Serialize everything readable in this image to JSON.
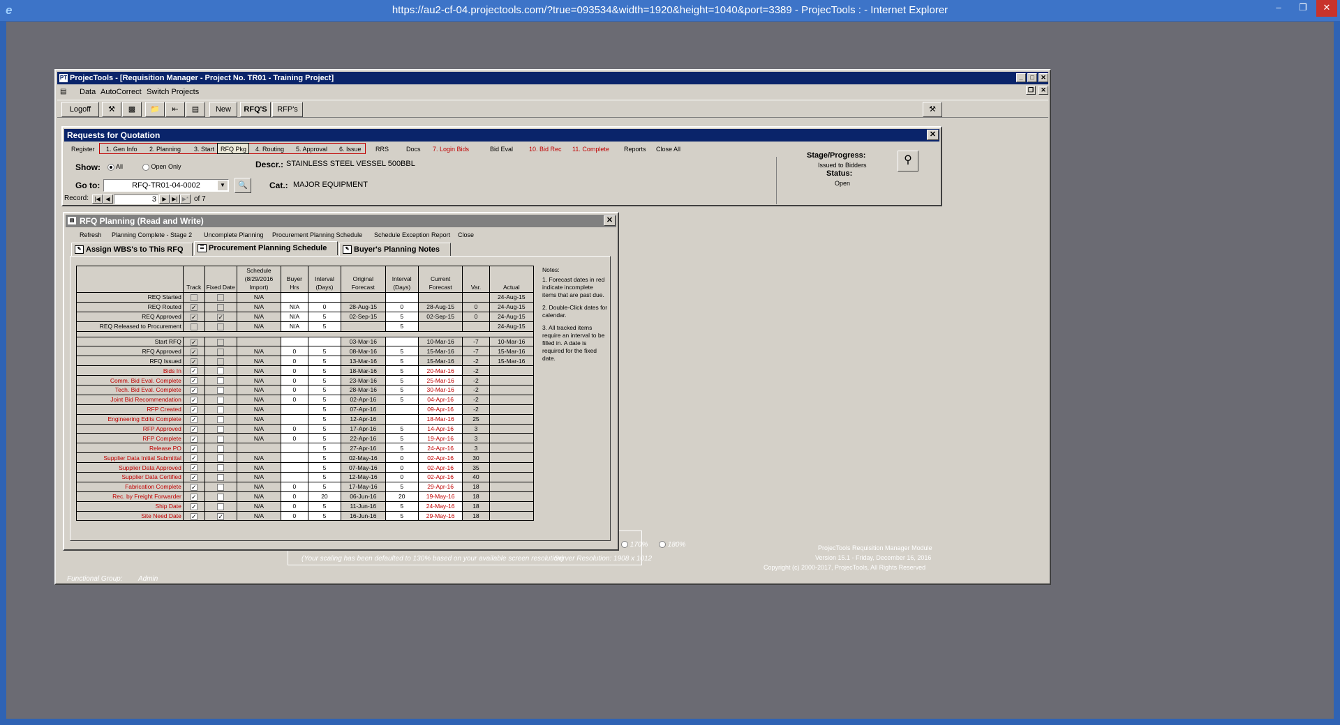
{
  "browser": {
    "title": "https://au2-cf-04.projectools.com/?true=093534&width=1920&height=1040&port=3389 - ProjecTools : - Internet Explorer"
  },
  "app": {
    "title": "ProjecTools - [Requisition Manager - Project No. TR01 - Training Project]",
    "menu": [
      "Data",
      "AutoCorrect",
      "Switch Projects"
    ],
    "toolbar": {
      "logoff": "Logoff",
      "new": "New",
      "rfqs": "RFQ'S",
      "rfps": "RFP's"
    }
  },
  "rfq": {
    "title": "Requests for Quotation",
    "nav": [
      "Register",
      "1. Gen Info",
      "2. Planning",
      "3. Start",
      "RFQ Pkg",
      "4. Routing",
      "5. Approval",
      "6. Issue",
      "RRS",
      "Docs",
      "7. Login Bids",
      "Bid Eval",
      "10. Bid Rec",
      "11. Complete",
      "Reports",
      "Close All"
    ],
    "show_label": "Show:",
    "show_all": "All",
    "show_open": "Open Only",
    "goto_label": "Go to:",
    "goto_value": "RFQ-TR01-04-0002",
    "descr_label": "Descr.:",
    "descr_value": "STAINLESS STEEL VESSEL 500BBL",
    "cat_label": "Cat.:",
    "cat_value": "MAJOR EQUIPMENT",
    "record_label": "Record:",
    "record_value": "3",
    "record_of": "of  7",
    "stage_label": "Stage/Progress:",
    "stage_value": "Issued to Bidders",
    "status_label": "Status:",
    "status_value": "Open"
  },
  "planning": {
    "title": "RFQ Planning (Read and Write)",
    "menu": [
      "Refresh",
      "Planning Complete - Stage 2",
      "Uncomplete Planning",
      "Procurement Planning Schedule",
      "Schedule Exception Report",
      "Close"
    ],
    "tabs": [
      "Assign WBS's to This RFQ",
      "Procurement Planning Schedule",
      "Buyer's Planning Notes"
    ],
    "headers": [
      "Track",
      "Fixed Date",
      "Schedule (8/29/2016 Import)",
      "Buyer Hrs",
      "Interval (Days)",
      "Original Forecast",
      "Interval (Days)",
      "Current Forecast",
      "Var.",
      "Actual"
    ],
    "rows": [
      {
        "label": "REQ Started",
        "red": false,
        "track": false,
        "fixed": false,
        "dis": true,
        "sched": "N/A",
        "hrs": "",
        "int1": "",
        "orig": "",
        "int2": "",
        "curr": "",
        "currRed": false,
        "var": "",
        "actual": "24-Aug-15"
      },
      {
        "label": "REQ Routed",
        "red": false,
        "track": true,
        "fixed": false,
        "dis": true,
        "sched": "N/A",
        "hrs": "N/A",
        "int1": "0",
        "orig": "28-Aug-15",
        "int2": "0",
        "curr": "28-Aug-15",
        "currRed": false,
        "var": "0",
        "actual": "24-Aug-15"
      },
      {
        "label": "REQ Approved",
        "red": false,
        "track": true,
        "fixed": true,
        "dis": true,
        "sched": "N/A",
        "hrs": "N/A",
        "int1": "5",
        "orig": "02-Sep-15",
        "int2": "5",
        "curr": "02-Sep-15",
        "currRed": false,
        "var": "0",
        "actual": "24-Aug-15"
      },
      {
        "label": "REQ Released to Procurement",
        "red": false,
        "track": false,
        "fixed": false,
        "dis": true,
        "sched": "N/A",
        "hrs": "N/A",
        "int1": "5",
        "orig": "",
        "int2": "5",
        "curr": "",
        "currRed": false,
        "var": "",
        "actual": "24-Aug-15"
      },
      {
        "label": "Start RFQ",
        "red": false,
        "track": true,
        "fixed": false,
        "dis": true,
        "sched": "",
        "hrs": "",
        "int1": "",
        "orig": "03-Mar-16",
        "int2": "",
        "curr": "10-Mar-16",
        "currRed": false,
        "var": "-7",
        "actual": "10-Mar-16"
      },
      {
        "label": "RFQ Approved",
        "red": false,
        "track": true,
        "fixed": false,
        "dis": true,
        "sched": "N/A",
        "hrs": "0",
        "int1": "5",
        "orig": "08-Mar-16",
        "int2": "5",
        "curr": "15-Mar-16",
        "currRed": false,
        "var": "-7",
        "actual": "15-Mar-16"
      },
      {
        "label": "RFQ Issued",
        "red": false,
        "track": true,
        "fixed": false,
        "dis": true,
        "sched": "N/A",
        "hrs": "0",
        "int1": "5",
        "orig": "13-Mar-16",
        "int2": "5",
        "curr": "15-Mar-16",
        "currRed": false,
        "var": "-2",
        "actual": "15-Mar-16"
      },
      {
        "label": "Bids In",
        "red": true,
        "track": true,
        "fixed": false,
        "dis": false,
        "sched": "N/A",
        "hrs": "0",
        "int1": "5",
        "orig": "18-Mar-16",
        "int2": "5",
        "curr": "20-Mar-16",
        "currRed": true,
        "var": "-2",
        "actual": ""
      },
      {
        "label": "Comm. Bid Eval. Complete",
        "red": true,
        "track": true,
        "fixed": false,
        "dis": false,
        "sched": "N/A",
        "hrs": "0",
        "int1": "5",
        "orig": "23-Mar-16",
        "int2": "5",
        "curr": "25-Mar-16",
        "currRed": true,
        "var": "-2",
        "actual": ""
      },
      {
        "label": "Tech. Bid Eval. Complete",
        "red": true,
        "track": true,
        "fixed": false,
        "dis": false,
        "sched": "N/A",
        "hrs": "0",
        "int1": "5",
        "orig": "28-Mar-16",
        "int2": "5",
        "curr": "30-Mar-16",
        "currRed": true,
        "var": "-2",
        "actual": ""
      },
      {
        "label": "Joint Bid Recommendation",
        "red": true,
        "track": true,
        "fixed": false,
        "dis": false,
        "sched": "N/A",
        "hrs": "0",
        "int1": "5",
        "orig": "02-Apr-16",
        "int2": "5",
        "curr": "04-Apr-16",
        "currRed": true,
        "var": "-2",
        "actual": ""
      },
      {
        "label": "RFP Created",
        "red": true,
        "track": true,
        "fixed": false,
        "dis": false,
        "sched": "N/A",
        "hrs": "",
        "int1": "5",
        "orig": "07-Apr-16",
        "int2": "",
        "curr": "09-Apr-16",
        "currRed": true,
        "var": "-2",
        "actual": ""
      },
      {
        "label": "Engineering Edits Complete",
        "red": true,
        "track": true,
        "fixed": false,
        "dis": false,
        "sched": "N/A",
        "hrs": "",
        "int1": "5",
        "orig": "12-Apr-16",
        "int2": "",
        "curr": "18-Mar-16",
        "currRed": true,
        "var": "25",
        "actual": ""
      },
      {
        "label": "RFP Approved",
        "red": true,
        "track": true,
        "fixed": false,
        "dis": false,
        "sched": "N/A",
        "hrs": "0",
        "int1": "5",
        "orig": "17-Apr-16",
        "int2": "5",
        "curr": "14-Apr-16",
        "currRed": true,
        "var": "3",
        "actual": ""
      },
      {
        "label": "RFP Complete",
        "red": true,
        "track": true,
        "fixed": false,
        "dis": false,
        "sched": "N/A",
        "hrs": "0",
        "int1": "5",
        "orig": "22-Apr-16",
        "int2": "5",
        "curr": "19-Apr-16",
        "currRed": true,
        "var": "3",
        "actual": ""
      },
      {
        "label": "Release PO",
        "red": true,
        "track": true,
        "fixed": false,
        "dis": false,
        "sched": "",
        "hrs": "",
        "int1": "5",
        "orig": "27-Apr-16",
        "int2": "5",
        "curr": "24-Apr-16",
        "currRed": true,
        "var": "3",
        "actual": ""
      },
      {
        "label": "Supplier Data Initial Submittal",
        "red": true,
        "track": true,
        "fixed": false,
        "dis": false,
        "sched": "N/A",
        "hrs": "",
        "int1": "5",
        "orig": "02-May-16",
        "int2": "0",
        "curr": "02-Apr-16",
        "currRed": true,
        "var": "30",
        "actual": ""
      },
      {
        "label": "Supplier Data Approved",
        "red": true,
        "track": true,
        "fixed": false,
        "dis": false,
        "sched": "N/A",
        "hrs": "",
        "int1": "5",
        "orig": "07-May-16",
        "int2": "0",
        "curr": "02-Apr-16",
        "currRed": true,
        "var": "35",
        "actual": ""
      },
      {
        "label": "Supplier Data Certified",
        "red": true,
        "track": true,
        "fixed": false,
        "dis": false,
        "sched": "N/A",
        "hrs": "",
        "int1": "5",
        "orig": "12-May-16",
        "int2": "0",
        "curr": "02-Apr-16",
        "currRed": true,
        "var": "40",
        "actual": ""
      },
      {
        "label": "Fabrication Complete",
        "red": true,
        "track": true,
        "fixed": false,
        "dis": false,
        "sched": "N/A",
        "hrs": "0",
        "int1": "5",
        "orig": "17-May-16",
        "int2": "5",
        "curr": "29-Apr-16",
        "currRed": true,
        "var": "18",
        "actual": ""
      },
      {
        "label": "Rec. by Freight Forwarder",
        "red": true,
        "track": true,
        "fixed": false,
        "dis": false,
        "sched": "N/A",
        "hrs": "0",
        "int1": "20",
        "orig": "06-Jun-16",
        "int2": "20",
        "curr": "19-May-16",
        "currRed": true,
        "var": "18",
        "actual": ""
      },
      {
        "label": "Ship Date",
        "red": true,
        "track": true,
        "fixed": false,
        "dis": false,
        "sched": "N/A",
        "hrs": "0",
        "int1": "5",
        "orig": "11-Jun-16",
        "int2": "5",
        "curr": "24-May-16",
        "currRed": true,
        "var": "18",
        "actual": ""
      },
      {
        "label": "Site Need Date",
        "red": true,
        "track": true,
        "fixed": true,
        "dis": false,
        "sched": "N/A",
        "hrs": "0",
        "int1": "5",
        "orig": "16-Jun-16",
        "int2": "5",
        "curr": "29-May-16",
        "currRed": true,
        "var": "18",
        "actual": ""
      }
    ],
    "notes": [
      "Notes:",
      "1. Forecast dates in red indicate incomplete items that are past due.",
      "2. Double-Click dates for calendar.",
      "3. All tracked items require an interval to be filled in. A date is required for the fixed date."
    ]
  },
  "background": {
    "functional_group_label": "Functional Group:",
    "functional_group_value": "Admin",
    "scaling_note": "(Your scaling has been defaulted to 130% based on your available screen resolution)",
    "server_res": "Server Resolution: 1908 x 1012",
    "zoom170": "170%",
    "zoom180": "180%",
    "module": "ProjecTools Requisition Manager Module",
    "version": "Version 15.1 - Friday, December 16, 2016",
    "copyright": "Copyright (c) 2000-2017, ProjecTools, All Rights Reserved"
  }
}
